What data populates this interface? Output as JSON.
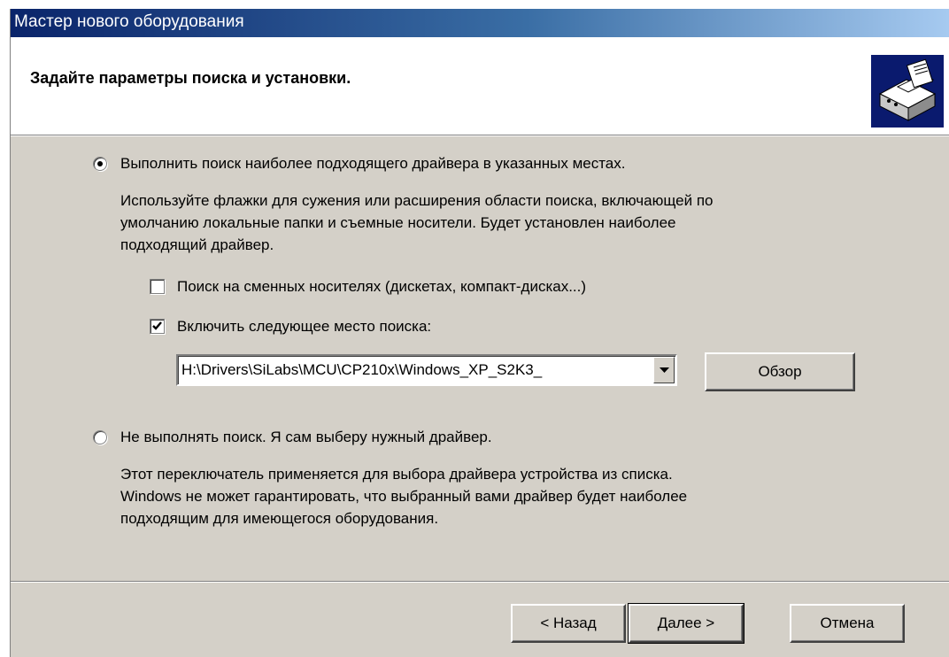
{
  "window": {
    "title": "Мастер нового оборудования"
  },
  "header": {
    "title": "Задайте параметры поиска и установки.",
    "icon": "hardware-wizard-icon"
  },
  "options": {
    "search": {
      "label": "Выполнить поиск наиболее подходящего драйвера в указанных местах.",
      "selected": true,
      "description": [
        "Используйте флажки для сужения или расширения области поиска, включающей по",
        "умолчанию локальные папки и съемные носители. Будет установлен наиболее",
        "подходящий драйвер."
      ],
      "removable_media": {
        "label": "Поиск на сменных носителях (дискетах, компакт-дисках...)",
        "checked": false
      },
      "include_location": {
        "label": "Включить следующее место поиска:",
        "checked": true
      },
      "path_value": "H:\\Drivers\\SiLabs\\MCU\\CP210x\\Windows_XP_S2K3_",
      "browse_label": "Обзор"
    },
    "manual": {
      "label": "Не выполнять поиск. Я сам выберу нужный драйвер.",
      "selected": false,
      "description": [
        "Этот переключатель применяется для выбора драйвера устройства из списка.",
        "Windows не может гарантировать, что выбранный вами драйвер будет наиболее",
        "подходящим для имеющегося оборудования."
      ]
    }
  },
  "footer": {
    "back_label": "< Назад",
    "next_label": "Далее >",
    "cancel_label": "Отмена"
  },
  "colors": {
    "titlebar_start": "#0a246a",
    "titlebar_end": "#a6caf0",
    "dialog_face": "#d4d0c8"
  }
}
